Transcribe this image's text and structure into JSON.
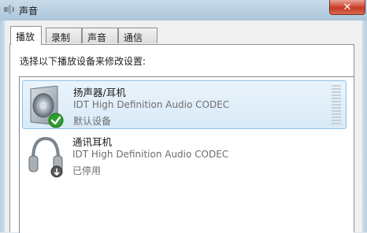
{
  "window": {
    "title": "声音",
    "close_label": "✕"
  },
  "tabs": [
    {
      "label": "播放",
      "active": true
    },
    {
      "label": "录制",
      "active": false
    },
    {
      "label": "声音",
      "active": false
    },
    {
      "label": "通信",
      "active": false
    }
  ],
  "playback": {
    "instruction": "选择以下播放设备来修改设置:",
    "devices": [
      {
        "name": "扬声器/耳机",
        "description": "IDT High Definition Audio CODEC",
        "status": "默认设备",
        "selected": true,
        "badge_icon": "default-check-icon"
      },
      {
        "name": "通讯耳机",
        "description": "IDT High Definition Audio CODEC",
        "status": "已停用",
        "selected": false,
        "badge_icon": "disabled-arrow-icon"
      }
    ]
  },
  "colors": {
    "selection": "#d8eaf8",
    "check_green": "#2e9e2e"
  }
}
